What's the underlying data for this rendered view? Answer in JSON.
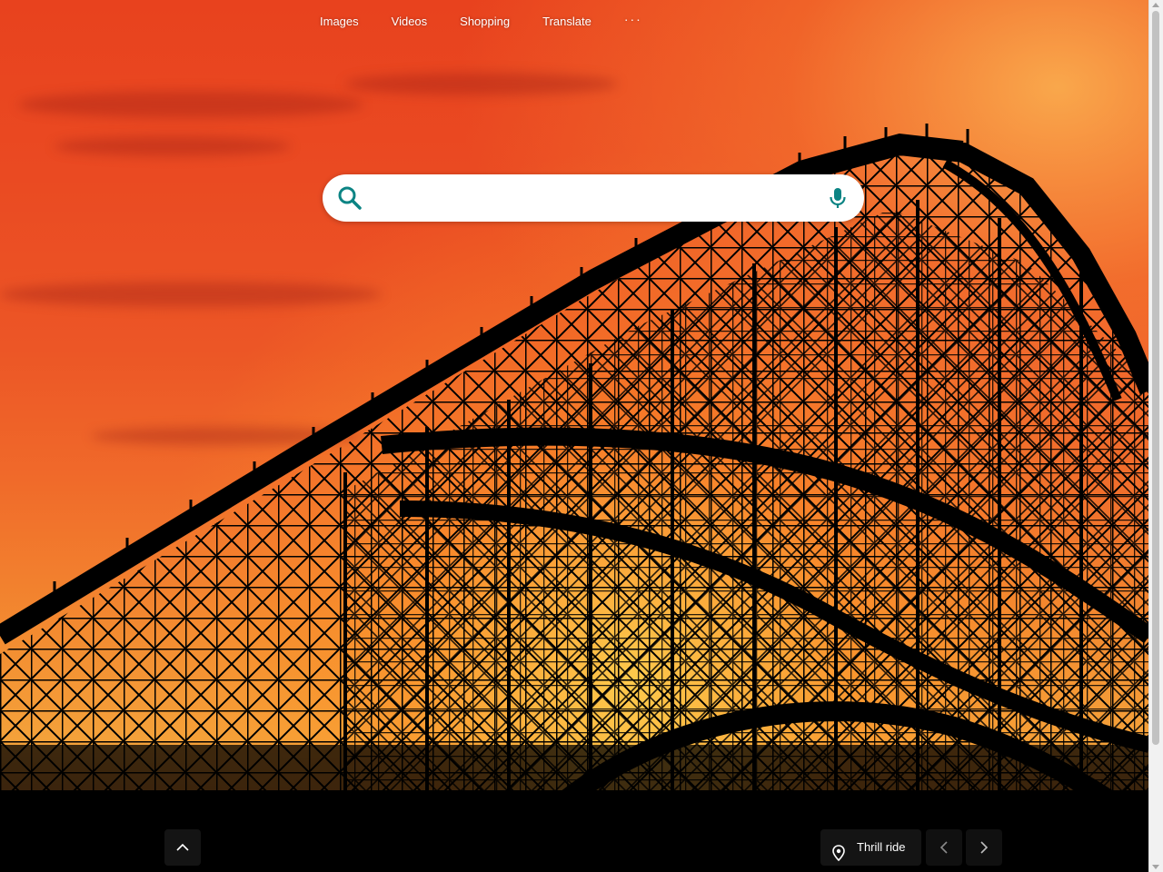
{
  "nav": {
    "links": [
      "Images",
      "Videos",
      "Shopping",
      "Translate"
    ],
    "more_label": "···"
  },
  "search": {
    "value": "",
    "placeholder": "",
    "accent_color": "#0c8484"
  },
  "background": {
    "location_label": "Thrill ride"
  },
  "icons": {
    "search": "search-icon",
    "mic": "microphone-icon",
    "scroll_up": "chevron-up-icon",
    "location": "location-pin-icon",
    "prev": "chevron-left-icon",
    "next": "chevron-right-icon"
  }
}
